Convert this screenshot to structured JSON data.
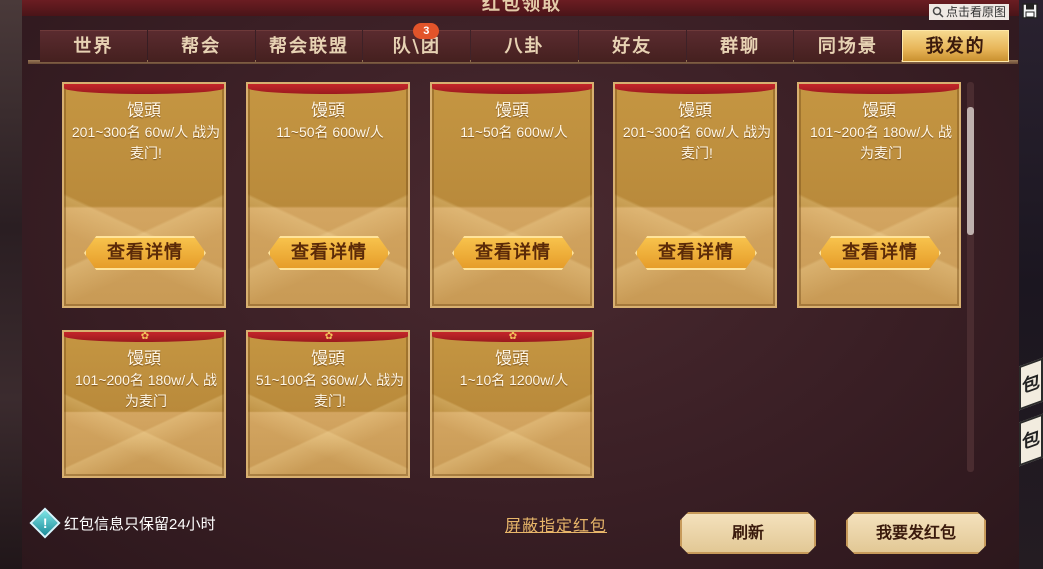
{
  "window": {
    "title": "红包领取",
    "view_original_label": "点击看原图"
  },
  "tabs": [
    {
      "label": "世界"
    },
    {
      "label": "帮会"
    },
    {
      "label": "帮会联盟"
    },
    {
      "label": "队\\团",
      "badge": "3"
    },
    {
      "label": "八卦"
    },
    {
      "label": "好友"
    },
    {
      "label": "群聊"
    },
    {
      "label": "同场景"
    },
    {
      "label": "我发的",
      "active": true
    }
  ],
  "cards": [
    {
      "name": "馒頭",
      "desc": "201~300名 60w/人 战为麦门!",
      "button": "查看详情"
    },
    {
      "name": "馒頭",
      "desc": "11~50名  600w/人",
      "button": "查看详情"
    },
    {
      "name": "馒頭",
      "desc": "11~50名 600w/人",
      "button": "查看详情"
    },
    {
      "name": "馒頭",
      "desc": "201~300名 60w/人 战为麦门!",
      "button": "查看详情"
    },
    {
      "name": "馒頭",
      "desc": "101~200名 180w/人 战为麦门",
      "button": "查看详情"
    },
    {
      "name": "馒頭",
      "desc": "101~200名 180w/人 战为麦门",
      "button": ""
    },
    {
      "name": "馒頭",
      "desc": "51~100名 360w/人 战为麦门!",
      "button": ""
    },
    {
      "name": "馒頭",
      "desc": "1~10名 1200w/人",
      "button": ""
    }
  ],
  "footer": {
    "hint": "红包信息只保留24小时",
    "block_link": "屏蔽指定红包",
    "refresh_button": "刷新",
    "send_button": "我要发红包"
  },
  "side_badges": [
    "包",
    "包"
  ],
  "colors": {
    "accent_gold": "#e7b558",
    "card_red": "#c4262a",
    "link": "#e8b66a"
  }
}
